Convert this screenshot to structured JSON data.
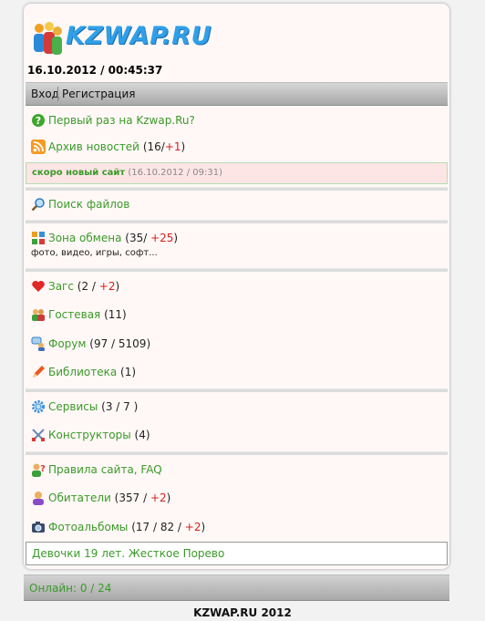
{
  "header": {
    "logo_text": "KZWAP.RU",
    "datetime": "16.10.2012 / 00:45:37"
  },
  "auth": {
    "login": "Вход",
    "register": "Регистрация"
  },
  "menu": {
    "first_time": {
      "label": "Первый раз на Kzwap.Ru?",
      "icon": "help-icon"
    },
    "news": {
      "label": "Архив новостей",
      "count": "(16/",
      "plus": "+1",
      "close": ")",
      "icon": "rss-icon"
    },
    "notice": {
      "title": "скоро новый сайт",
      "time": "(16.10.2012 / 09:31)"
    },
    "search": {
      "label": "Поиск файлов",
      "icon": "search-icon"
    },
    "exchange": {
      "label": "Зона обмена",
      "count": "(35/ ",
      "plus": "+25",
      "close": ")",
      "sub": "фото, видео, игры, софт...",
      "icon": "grid-icon"
    },
    "zags": {
      "label": "Загс",
      "count": "(2 / ",
      "plus": "+2",
      "close": ")",
      "icon": "heart-icon"
    },
    "guestbook": {
      "label": "Гостевая",
      "count": "(11)",
      "icon": "users-icon"
    },
    "forum": {
      "label": "Форум",
      "count": "(97 / 5109)",
      "icon": "forum-icon"
    },
    "library": {
      "label": "Библиотека",
      "count": "(1)",
      "icon": "pencil-icon"
    },
    "services": {
      "label": "Сервисы",
      "count": "(3 / 7 )",
      "icon": "gear-icon"
    },
    "constructors": {
      "label": "Конструкторы",
      "count": "(4)",
      "icon": "tools-icon"
    },
    "rules": {
      "label": "Правила сайта, FAQ",
      "icon": "user-help-icon"
    },
    "residents": {
      "label": "Обитатели",
      "count": "(357 / ",
      "plus": "+2",
      "close": ")",
      "icon": "user-icon"
    },
    "photoalbums": {
      "label": "Фотоальбомы",
      "count": "(17 / 82 / ",
      "plus": "+2",
      "close": ")",
      "icon": "camera-icon"
    }
  },
  "ad": {
    "text": "Девочки 19 лет. Жесткое Порево"
  },
  "online": {
    "text": "Онлайн: 0 / 24"
  },
  "footer": {
    "text": "KZWAP.RU 2012"
  },
  "colors": {
    "link": "#3b9a2a",
    "plus": "#d42020",
    "logo": "#2fa0e8"
  }
}
